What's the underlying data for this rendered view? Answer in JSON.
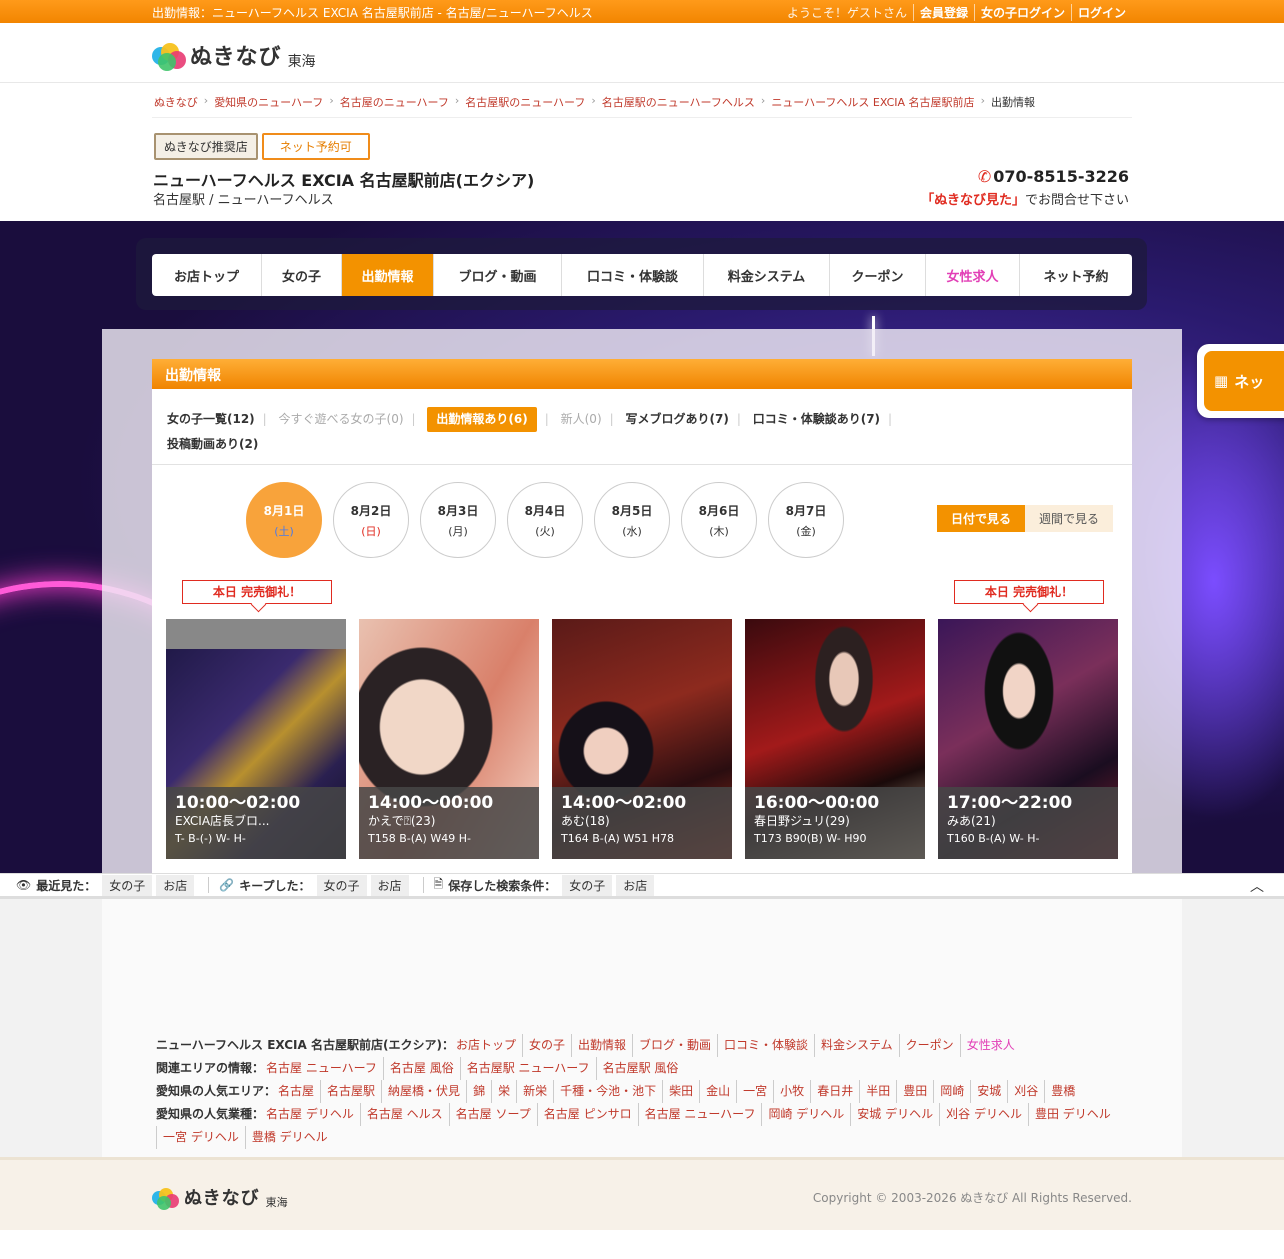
{
  "topbar": {
    "page_title": "出勤情報：ニューハーフヘルス EXCIA 名古屋駅前店 - 名古屋/ニューハーフヘルス",
    "welcome": "ようこそ！ゲストさん",
    "register": "会員登録",
    "girl_login": "女の子ログイン",
    "login": "ログイン"
  },
  "logo": {
    "text": "ぬきなび",
    "region": "東海"
  },
  "breadcrumb": [
    "ぬきなび",
    "愛知県のニューハーフ",
    "名古屋のニューハーフ",
    "名古屋駅のニューハーフ",
    "名古屋駅のニューハーフヘルス",
    "ニューハーフヘルス EXCIA 名古屋駅前店",
    "出勤情報"
  ],
  "shop": {
    "badge_recommended": "ぬきなび推奨店",
    "badge_reserve": "ネット予約可",
    "name": "ニューハーフヘルス EXCIA 名古屋駅前店(エクシア)",
    "area": "名古屋駅 / ニューハーフヘルス",
    "phone": "070-8515-3226",
    "phone_note_bold": "「ぬきなび見た」",
    "phone_note": "でお問合せ下さい"
  },
  "nav": [
    "お店トップ",
    "女の子",
    "出勤情報",
    "ブログ・動画",
    "口コミ・体験談",
    "料金システム",
    "クーポン",
    "女性求人",
    "ネット予約"
  ],
  "side_tab": {
    "label": "ネッ"
  },
  "panel": {
    "title": "出勤情報",
    "filters": {
      "all": "女の子一覧(12)",
      "now": "今すぐ遊べる女の子(0)",
      "working": "出勤情報あり(6)",
      "new": "新人(0)",
      "photoblog": "写メブログあり(7)",
      "review": "口コミ・体験談あり(7)",
      "video": "投稿動画あり(2)"
    },
    "dates": [
      {
        "d": "8月1日",
        "w": "(土)"
      },
      {
        "d": "8月2日",
        "w": "(日)"
      },
      {
        "d": "8月3日",
        "w": "(月)"
      },
      {
        "d": "8月4日",
        "w": "(火)"
      },
      {
        "d": "8月5日",
        "w": "(水)"
      },
      {
        "d": "8月6日",
        "w": "(木)"
      },
      {
        "d": "8月7日",
        "w": "(金)"
      }
    ],
    "view_day": "日付で見る",
    "view_week": "週間で見る",
    "sold_label": "本日 完売御礼！",
    "cards": [
      {
        "time": "10:00〜02:00",
        "name": "EXCIA店長ブロ...",
        "meas": "T- B-(-) W- H-"
      },
      {
        "time": "14:00〜00:00",
        "name": "かえで⍰(23)",
        "meas": "T158 B-(A) W49 H-"
      },
      {
        "time": "14:00〜02:00",
        "name": "あむ(18)",
        "meas": "T164 B-(A) W51 H78"
      },
      {
        "time": "16:00〜00:00",
        "name": "春日野ジュリ(29)",
        "meas": "T173 B90(B) W- H90"
      },
      {
        "time": "17:00〜22:00",
        "name": "みあ(21)",
        "meas": "T160 B-(A) W- H-"
      }
    ]
  },
  "fixedbar": {
    "recent": "最近見た：",
    "kept": "キープした：",
    "saved": "保存した検索条件：",
    "girl": "女の子",
    "shop": "お店"
  },
  "links": {
    "shop_label": "ニューハーフヘルス EXCIA 名古屋駅前店(エクシア)：",
    "shop_links": [
      "お店トップ",
      "女の子",
      "出勤情報",
      "ブログ・動画",
      "口コミ・体験談",
      "料金システム",
      "クーポン",
      "女性求人"
    ],
    "area_label": "関連エリアの情報：",
    "area_links": [
      "名古屋 ニューハーフ",
      "名古屋 風俗",
      "名古屋駅 ニューハーフ",
      "名古屋駅 風俗"
    ],
    "pop_area_label": "愛知県の人気エリア：",
    "pop_area_links": [
      "名古屋",
      "名古屋駅",
      "納屋橋・伏見",
      "錦",
      "栄",
      "新栄",
      "千種・今池・池下",
      "柴田",
      "金山",
      "一宮",
      "小牧",
      "春日井",
      "半田",
      "豊田",
      "岡崎",
      "安城",
      "刈谷",
      "豊橋"
    ],
    "pop_type_label": "愛知県の人気業種：",
    "pop_type_links": [
      "名古屋 デリヘル",
      "名古屋 ヘルス",
      "名古屋 ソープ",
      "名古屋 ピンサロ",
      "名古屋 ニューハーフ",
      "岡崎 デリヘル",
      "安城 デリヘル",
      "刈谷 デリヘル",
      "豊田 デリヘル",
      "一宮 デリヘル",
      "豊橋 デリヘル"
    ]
  },
  "footer": {
    "copyright": "Copyright © 2003-2026 ぬきなび All Rights Reserved."
  }
}
